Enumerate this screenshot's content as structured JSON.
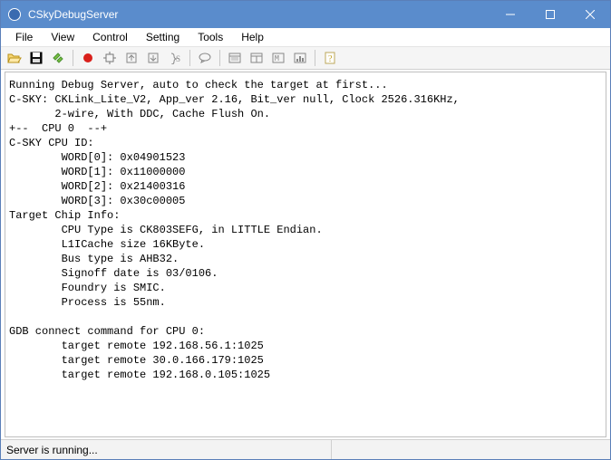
{
  "window": {
    "title": "CSkyDebugServer"
  },
  "menu": {
    "file": "File",
    "view": "View",
    "control": "Control",
    "setting": "Setting",
    "tools": "Tools",
    "help": "Help"
  },
  "toolbar_icons": {
    "open": "open-icon",
    "save": "save-icon",
    "connect": "connect-icon",
    "record": "record-icon",
    "chip": "chip-icon",
    "upload": "upload-icon",
    "download": "download-icon",
    "script": "script-icon",
    "chat": "chat-icon",
    "window1": "window1-icon",
    "window2": "window2-icon",
    "memory": "memory-icon",
    "histogram": "histogram-icon",
    "help": "help-icon"
  },
  "console": {
    "lines": [
      "Running Debug Server, auto to check the target at first...",
      "C-SKY: CKLink_Lite_V2, App_ver 2.16, Bit_ver null, Clock 2526.316KHz,",
      "       2-wire, With DDC, Cache Flush On.",
      "+--  CPU 0  --+",
      "C-SKY CPU ID:",
      "\tWORD[0]: 0x04901523",
      "\tWORD[1]: 0x11000000",
      "\tWORD[2]: 0x21400316",
      "\tWORD[3]: 0x30c00005",
      "Target Chip Info:",
      "\tCPU Type is CK803SEFG, in LITTLE Endian.",
      "\tL1ICache size 16KByte.",
      "\tBus type is AHB32.",
      "\tSignoff date is 03/0106.",
      "\tFoundry is SMIC.",
      "\tProcess is 55nm.",
      "",
      "GDB connect command for CPU 0:",
      "\ttarget remote 192.168.56.1:1025",
      "\ttarget remote 30.0.166.179:1025",
      "\ttarget remote 192.168.0.105:1025",
      ""
    ]
  },
  "status": {
    "text": "Server is running..."
  }
}
